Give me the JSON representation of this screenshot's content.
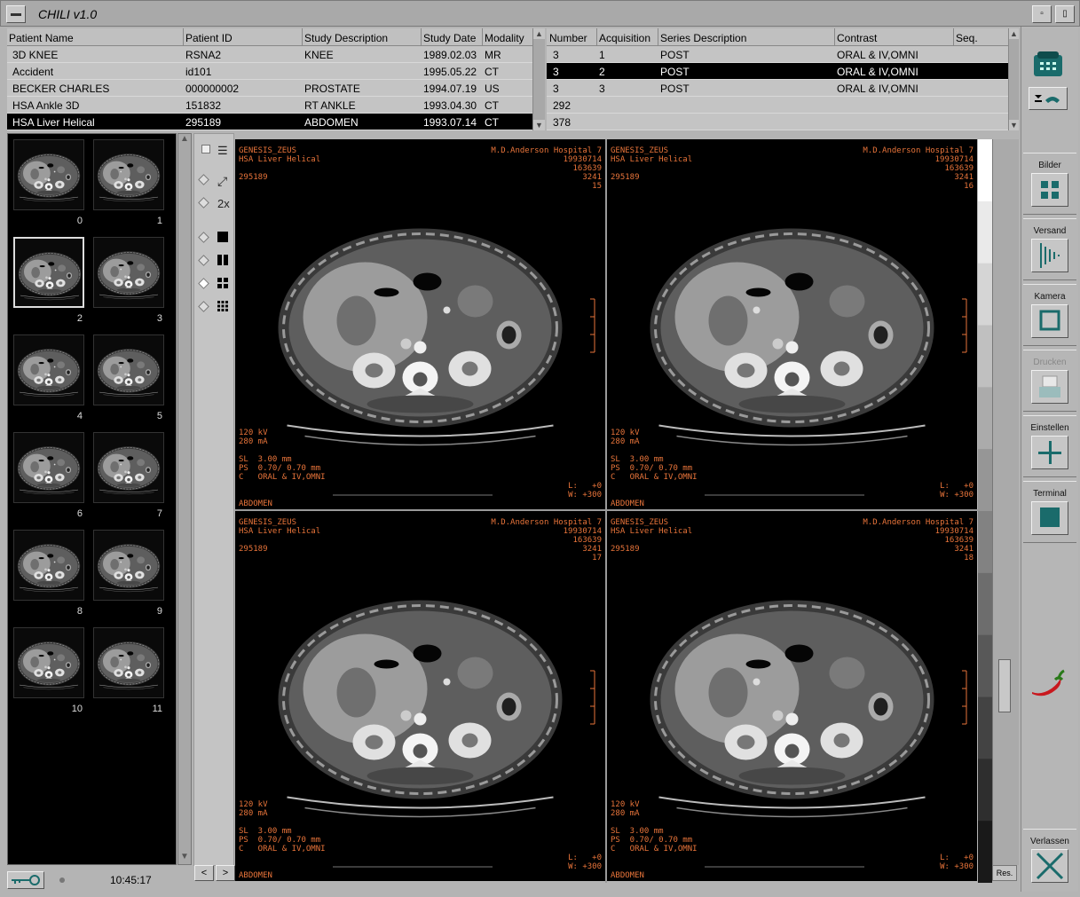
{
  "window": {
    "title": "CHILI v1.0"
  },
  "patients": {
    "headers": [
      "Patient Name",
      "Patient ID",
      "Study Description",
      "Study Date",
      "Modality"
    ],
    "rows": [
      [
        "3D KNEE",
        "RSNA2",
        "KNEE",
        "1989.02.03",
        "MR"
      ],
      [
        "Accident",
        "id101",
        "",
        "1995.05.22",
        "CT"
      ],
      [
        "BECKER CHARLES",
        "000000002",
        "PROSTATE",
        "1994.07.19",
        "US"
      ],
      [
        "HSA Ankle 3D",
        "151832",
        "RT ANKLE",
        "1993.04.30",
        "CT"
      ],
      [
        "HSA Liver Helical",
        "295189",
        "ABDOMEN",
        "1993.07.14",
        "CT"
      ]
    ],
    "selected_row": 4
  },
  "series": {
    "headers": [
      "Number",
      "Acquisition",
      "Series Description",
      "Contrast",
      "Seq."
    ],
    "rows": [
      [
        "3",
        "1",
        "POST",
        "ORAL & IV,OMNI",
        ""
      ],
      [
        "3",
        "2",
        "POST",
        "ORAL & IV,OMNI",
        ""
      ],
      [
        "3",
        "3",
        "POST",
        "ORAL & IV,OMNI",
        ""
      ],
      [
        "292",
        "",
        "",
        "",
        ""
      ],
      [
        "378",
        "",
        "",
        "",
        ""
      ]
    ],
    "selected_row": 1
  },
  "thumbnails": [
    "0",
    "1",
    "2",
    "3",
    "4",
    "5",
    "6",
    "7",
    "8",
    "9",
    "10",
    "11"
  ],
  "active_thumbnail": 2,
  "tools": {
    "zoom_label": "2x"
  },
  "viewports": [
    {
      "scanner": "GENESIS_ZEUS",
      "hospital": "M.D.Anderson Hospital 7",
      "study": "HSA Liver Helical",
      "date": "19930714",
      "time": "163639",
      "num1": "3241",
      "image": "15",
      "pid": "295189",
      "kv": "120 kV",
      "ma": "280 mA",
      "sl": "SL  3.00 mm",
      "ps": "PS  0.70/ 0.70 mm",
      "c": "C   ORAL & IV,OMNI",
      "l": "L:   +0",
      "w": "W: +300",
      "region": "ABDOMEN"
    },
    {
      "scanner": "GENESIS_ZEUS",
      "hospital": "M.D.Anderson Hospital 7",
      "study": "HSA Liver Helical",
      "date": "19930714",
      "time": "163639",
      "num1": "3241",
      "image": "16",
      "pid": "295189",
      "kv": "120 kV",
      "ma": "280 mA",
      "sl": "SL  3.00 mm",
      "ps": "PS  0.70/ 0.70 mm",
      "c": "C   ORAL & IV,OMNI",
      "l": "L:   +0",
      "w": "W: +300",
      "region": "ABDOMEN"
    },
    {
      "scanner": "GENESIS_ZEUS",
      "hospital": "M.D.Anderson Hospital 7",
      "study": "HSA Liver Helical",
      "date": "19930714",
      "time": "163639",
      "num1": "3241",
      "image": "17",
      "pid": "295189",
      "kv": "120 kV",
      "ma": "280 mA",
      "sl": "SL  3.00 mm",
      "ps": "PS  0.70/ 0.70 mm",
      "c": "C   ORAL & IV,OMNI",
      "l": "L:   +0",
      "w": "W: +300",
      "region": "ABDOMEN"
    },
    {
      "scanner": "GENESIS_ZEUS",
      "hospital": "M.D.Anderson Hospital 7",
      "study": "HSA Liver Helical",
      "date": "19930714",
      "time": "163639",
      "num1": "3241",
      "image": "18",
      "pid": "295189",
      "kv": "120 kV",
      "ma": "280 mA",
      "sl": "SL  3.00 mm",
      "ps": "PS  0.70/ 0.70 mm",
      "c": "C   ORAL & IV,OMNI",
      "l": "L:   +0",
      "w": "W: +300",
      "region": "ABDOMEN"
    }
  ],
  "sidebar": {
    "bilder": "Bilder",
    "versand": "Versand",
    "kamera": "Kamera",
    "drucken": "Drucken",
    "einstellen": "Einstellen",
    "terminal": "Terminal",
    "verlassen": "Verlassen"
  },
  "status": {
    "time": "10:45:17"
  },
  "nav": {
    "prev": "<",
    "next": ">",
    "res": "Res."
  },
  "colors": {
    "accent": "#1a6b6b",
    "overlay": "#e8743a",
    "selection": "#000000"
  }
}
